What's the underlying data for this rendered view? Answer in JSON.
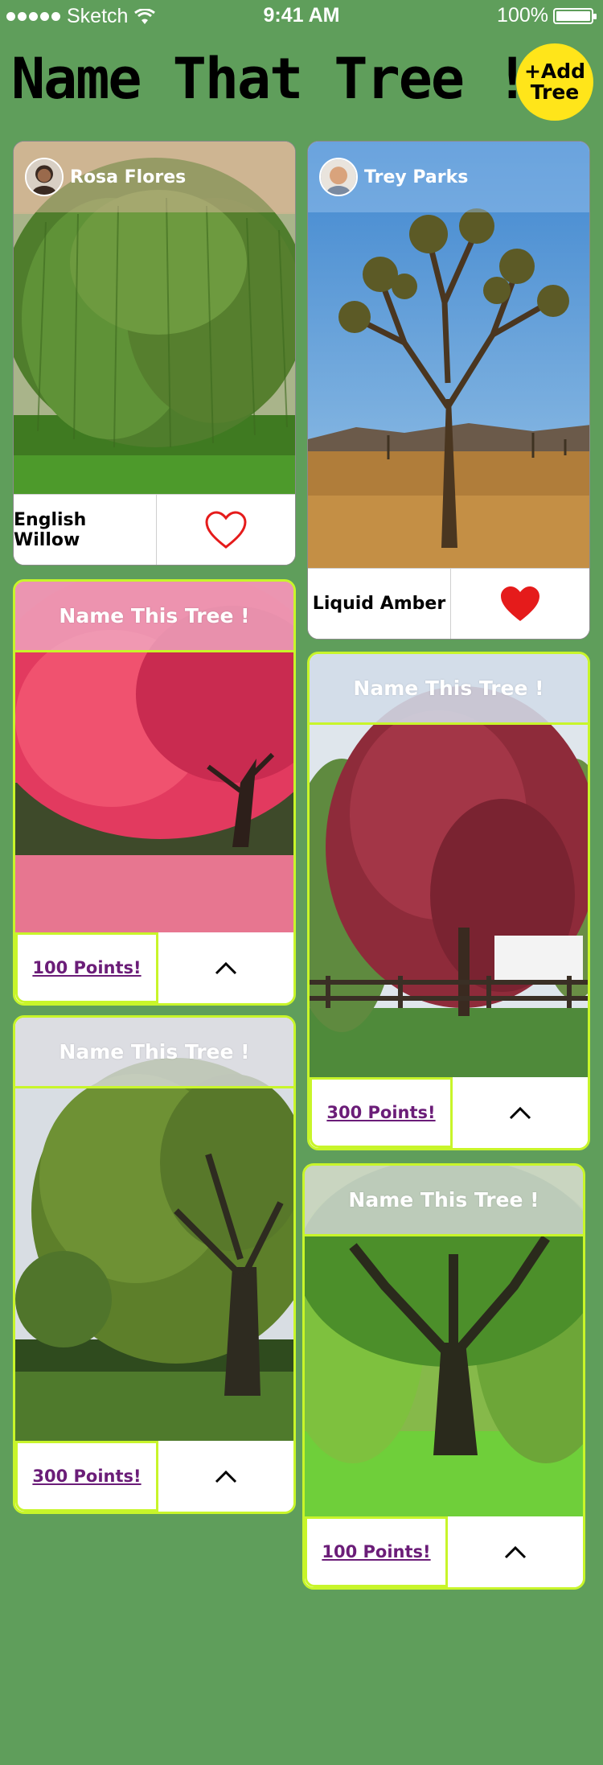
{
  "status_bar": {
    "carrier": "Sketch",
    "time": "9:41 AM",
    "battery": "100%"
  },
  "header": {
    "title": "Name That Tree !",
    "add_button": "+Add\nTree"
  },
  "cards": [
    {
      "type": "posted",
      "user": "Rosa Flores",
      "tree_name": "English Willow",
      "liked": false,
      "photo": "weeping-willow"
    },
    {
      "type": "posted",
      "user": "Trey Parks",
      "tree_name": "Liquid Amber",
      "liked": true,
      "photo": "joshua-tree"
    },
    {
      "type": "challenge",
      "title": "Name This Tree !",
      "points": "100 Points!",
      "photo": "pink-maple"
    },
    {
      "type": "challenge",
      "title": "Name This Tree !",
      "points": "300 Points!",
      "photo": "red-maple"
    },
    {
      "type": "challenge",
      "title": "Name This Tree !",
      "points": "300 Points!",
      "photo": "oak"
    },
    {
      "type": "challenge",
      "title": "Name This Tree !",
      "points": "100 Points!",
      "photo": "green-forest-tree"
    }
  ],
  "colors": {
    "background": "#5f9e5b",
    "accent_yellow": "#ffe51a",
    "challenge_border": "#c8f52a",
    "points_text": "#6b1d78",
    "heart": "#e51b1b"
  }
}
